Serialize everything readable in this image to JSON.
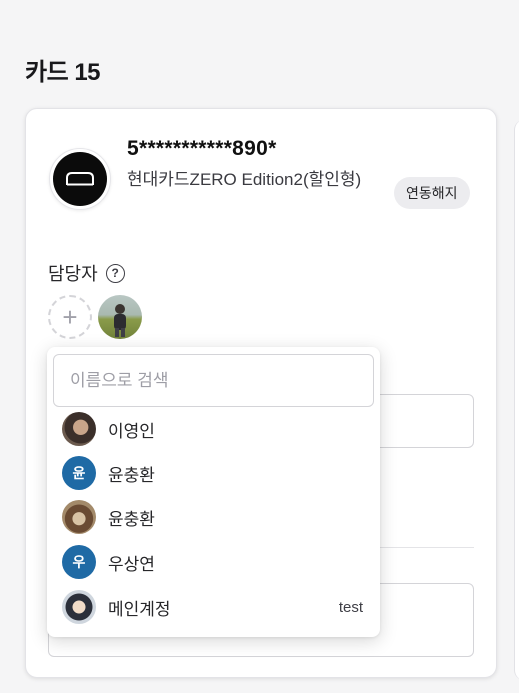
{
  "page": {
    "title": "카드 15"
  },
  "card": {
    "number": "5***********890*",
    "name": "현대카드ZERO Edition2(할인형)",
    "unlink_label": "연동해지",
    "manager_label": "담당자",
    "help_icon": "question-circle-icon",
    "add_icon": "plus-icon"
  },
  "dropdown": {
    "search_placeholder": "이름으로 검색",
    "search_value": "",
    "options": [
      {
        "name": "이영인",
        "avatar": "photo",
        "initial": "",
        "tag": ""
      },
      {
        "name": "윤충환",
        "avatar": "initial",
        "initial": "윤",
        "tag": ""
      },
      {
        "name": "윤충환",
        "avatar": "photo",
        "initial": "",
        "tag": ""
      },
      {
        "name": "우상연",
        "avatar": "initial",
        "initial": "우",
        "tag": ""
      },
      {
        "name": "메인계정",
        "avatar": "photo",
        "initial": "",
        "tag": "test"
      }
    ]
  },
  "colors": {
    "initial_avatar_bg": "#1f6aa5",
    "button_bg": "#ececef",
    "page_bg": "#f5f5f6"
  }
}
